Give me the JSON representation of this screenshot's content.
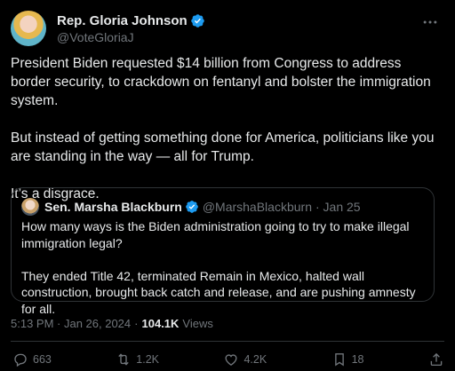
{
  "tweet": {
    "author": {
      "display_name": "Rep. Gloria Johnson",
      "handle": "@VoteGloriaJ"
    },
    "paragraphs": [
      "President Biden requested $14 billion from Congress to address border security, to crackdown on fentanyl and bolster the immigration system.",
      "But instead of getting something done for America, politicians like you are standing in the way — all for Trump.",
      "It’s a disgrace."
    ],
    "quote": {
      "display_name": "Sen. Marsha Blackburn",
      "handle": "@MarshaBlackburn",
      "date": "· Jan 25",
      "paragraphs": [
        "How many ways is the Biden administration going to try to make illegal immigration legal?",
        "They ended Title 42, terminated Remain in Mexico, halted wall construction, brought back catch and release, and are pushing amnesty for all."
      ]
    },
    "timestamp": "5:13 PM · Jan 26, 2024",
    "separator": "·",
    "views_count": "104.1K",
    "views_label": "Views",
    "actions": {
      "replies": "663",
      "reposts": "1.2K",
      "likes": "4.2K",
      "bookmarks": "18"
    }
  },
  "colors": {
    "background": "#000000",
    "text": "#e7e9ea",
    "muted": "#71767b",
    "border": "#2f3336",
    "verified_blue": "#1d9bf0"
  },
  "icons": [
    "more-icon",
    "verified-badge-icon",
    "reply-icon",
    "repost-icon",
    "like-icon",
    "bookmark-icon",
    "share-icon"
  ]
}
